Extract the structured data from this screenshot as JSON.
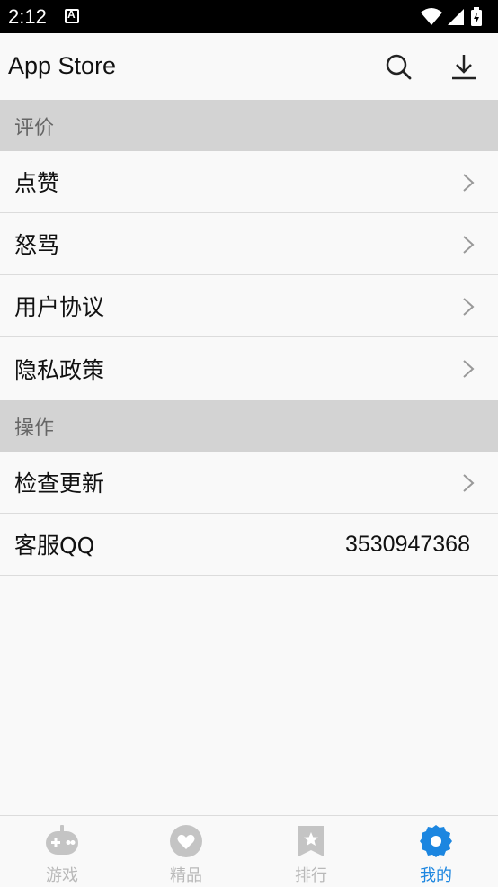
{
  "status_bar": {
    "time": "2:12",
    "notification_letter": "A"
  },
  "app_bar": {
    "title": "App Store",
    "search_icon": "search-icon",
    "download_icon": "download-icon"
  },
  "sections": [
    {
      "header": "评价",
      "items": [
        "点赞",
        "怒骂",
        "用户协议",
        "隐私政策"
      ]
    },
    {
      "header": "操作",
      "items": [
        "检查更新"
      ]
    }
  ],
  "support": {
    "label": "客服QQ",
    "value": "3530947368"
  },
  "bottom_nav": {
    "active_color": "#1c86e0",
    "inactive_color": "#b9b9b9",
    "items": [
      {
        "label": "游戏",
        "icon": "gamepad-icon",
        "active": false
      },
      {
        "label": "精品",
        "icon": "heart-icon",
        "active": false
      },
      {
        "label": "排行",
        "icon": "bookmark-star-icon",
        "active": false
      },
      {
        "label": "我的",
        "icon": "gear-icon",
        "active": true
      }
    ]
  }
}
